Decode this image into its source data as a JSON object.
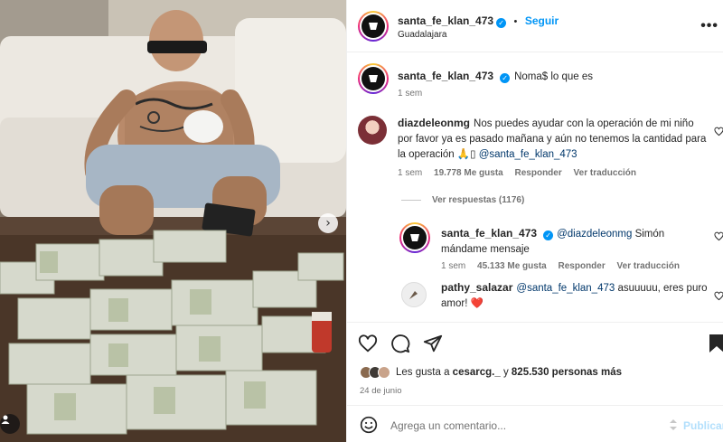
{
  "post_author": {
    "username": "santa_fe_klan_473",
    "location": "Guadalajara",
    "follow_label": "Seguir"
  },
  "caption": {
    "username": "santa_fe_klan_473",
    "text": "Noma$ lo que es",
    "time": "1 sem"
  },
  "comments": [
    {
      "username": "diazdeleonmg",
      "text": "Nos puedes ayudar con la operación de mi niño por favor ya es pasado mañana y aún no tenemos la cantidad para la operación 🙏▯",
      "mention": "@santa_fe_klan_473",
      "time": "1 sem",
      "likes": "19.778 Me gusta",
      "reply": "Responder",
      "translate": "Ver traducción"
    }
  ],
  "view_replies": "Ver respuestas (1176)",
  "replies": [
    {
      "username": "santa_fe_klan_473",
      "mention": "@diazdeleonmg",
      "text": "Simón mándame mensaje",
      "time": "1 sem",
      "likes": "45.133 Me gusta",
      "reply": "Responder",
      "translate": "Ver traducción"
    },
    {
      "username": "pathy_salazar",
      "mention": "@santa_fe_klan_473",
      "text": "asuuuuu, eres puro amor!",
      "emoji": "❤️"
    }
  ],
  "likes_summary": {
    "prefix": "Les gusta a",
    "user": "cesarcg._",
    "connector": "y",
    "count": "825.530 personas más"
  },
  "date": "24 de junio",
  "comment_box": {
    "placeholder": "Agrega un comentario...",
    "publish_label": "Publicar"
  },
  "icons": {
    "more": "more-options-icon",
    "like": "heart-icon",
    "comment": "comment-icon",
    "share": "send-icon",
    "save": "bookmark-icon",
    "emoji": "smiley-icon",
    "next": "chevron-right-icon",
    "user_tag": "user-tag-icon"
  },
  "colors": {
    "accent": "#0095f6",
    "mention": "#00376b",
    "muted": "#737373",
    "heart": "#ed4956"
  }
}
